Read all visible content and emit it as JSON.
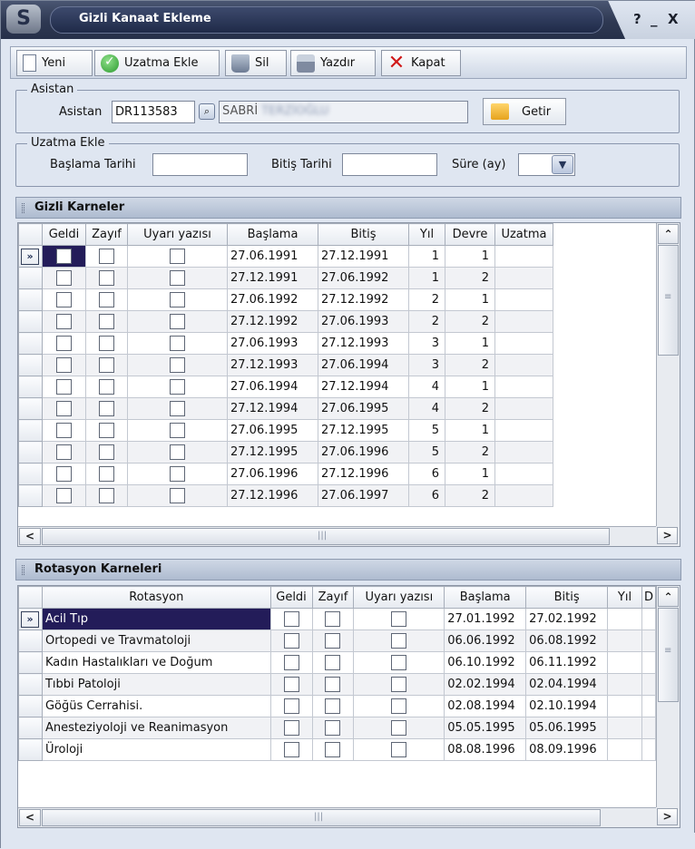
{
  "window": {
    "title": "Gizli Kanaat Ekleme",
    "controls": [
      "?",
      "_",
      "X"
    ]
  },
  "toolbar": [
    {
      "label": "Yeni",
      "icon": "new-document-icon"
    },
    {
      "label": "Uzatma Ekle",
      "icon": "green-check-icon"
    },
    {
      "label": "Sil",
      "icon": "trash-icon"
    },
    {
      "label": "Yazdır",
      "icon": "printer-icon"
    },
    {
      "label": "Kapat",
      "icon": "red-x-icon"
    }
  ],
  "asistan_group": {
    "legend": "Asistan",
    "label": "Asistan",
    "code": "DR113583",
    "name_prefix": "SABRİ",
    "name_blurred": "TERZİOĞLU",
    "getir_label": "Getir"
  },
  "uzatma_group": {
    "legend": "Uzatma Ekle",
    "start_label": "Başlama Tarihi",
    "start_value": "",
    "end_label": "Bitiş Tarihi",
    "end_value": "",
    "duration_label": "Süre (ay)",
    "duration_value": ""
  },
  "gizli_karneler": {
    "title": "Gizli Karneler",
    "columns": [
      "Geldi",
      "Zayıf",
      "Uyarı yazısı",
      "Başlama",
      "Bitiş",
      "Yıl",
      "Devre",
      "Uzatma"
    ],
    "rows": [
      {
        "baslama": "27.06.1991",
        "bitis": "27.12.1991",
        "yil": "1",
        "devre": "1"
      },
      {
        "baslama": "27.12.1991",
        "bitis": "27.06.1992",
        "yil": "1",
        "devre": "2"
      },
      {
        "baslama": "27.06.1992",
        "bitis": "27.12.1992",
        "yil": "2",
        "devre": "1"
      },
      {
        "baslama": "27.12.1992",
        "bitis": "27.06.1993",
        "yil": "2",
        "devre": "2"
      },
      {
        "baslama": "27.06.1993",
        "bitis": "27.12.1993",
        "yil": "3",
        "devre": "1"
      },
      {
        "baslama": "27.12.1993",
        "bitis": "27.06.1994",
        "yil": "3",
        "devre": "2"
      },
      {
        "baslama": "27.06.1994",
        "bitis": "27.12.1994",
        "yil": "4",
        "devre": "1"
      },
      {
        "baslama": "27.12.1994",
        "bitis": "27.06.1995",
        "yil": "4",
        "devre": "2"
      },
      {
        "baslama": "27.06.1995",
        "bitis": "27.12.1995",
        "yil": "5",
        "devre": "1"
      },
      {
        "baslama": "27.12.1995",
        "bitis": "27.06.1996",
        "yil": "5",
        "devre": "2"
      },
      {
        "baslama": "27.06.1996",
        "bitis": "27.12.1996",
        "yil": "6",
        "devre": "1"
      },
      {
        "baslama": "27.12.1996",
        "bitis": "27.06.1997",
        "yil": "6",
        "devre": "2"
      }
    ]
  },
  "rotasyon_karneleri": {
    "title": "Rotasyon Karneleri",
    "columns": [
      "Rotasyon",
      "Geldi",
      "Zayıf",
      "Uyarı yazısı",
      "Başlama",
      "Bitiş",
      "Yıl",
      "D"
    ],
    "rows": [
      {
        "rotasyon": "Acil Tıp",
        "baslama": "27.01.1992",
        "bitis": "27.02.1992"
      },
      {
        "rotasyon": "Ortopedi ve Travmatoloji",
        "baslama": "06.06.1992",
        "bitis": "06.08.1992"
      },
      {
        "rotasyon": "Kadın Hastalıkları ve Doğum",
        "baslama": "06.10.1992",
        "bitis": "06.11.1992"
      },
      {
        "rotasyon": "Tıbbi Patoloji",
        "baslama": "02.02.1994",
        "bitis": "02.04.1994"
      },
      {
        "rotasyon": "Göğüs Cerrahisi.",
        "baslama": "02.08.1994",
        "bitis": "02.10.1994"
      },
      {
        "rotasyon": "Anesteziyoloji ve Reanimasyon",
        "baslama": "05.05.1995",
        "bitis": "05.06.1995"
      },
      {
        "rotasyon": "Üroloji",
        "baslama": "08.08.1996",
        "bitis": "08.09.1996"
      }
    ]
  },
  "colors": {
    "selection": "#231c59",
    "titlebar": "#2e3852",
    "panel": "#dfe6f1"
  }
}
